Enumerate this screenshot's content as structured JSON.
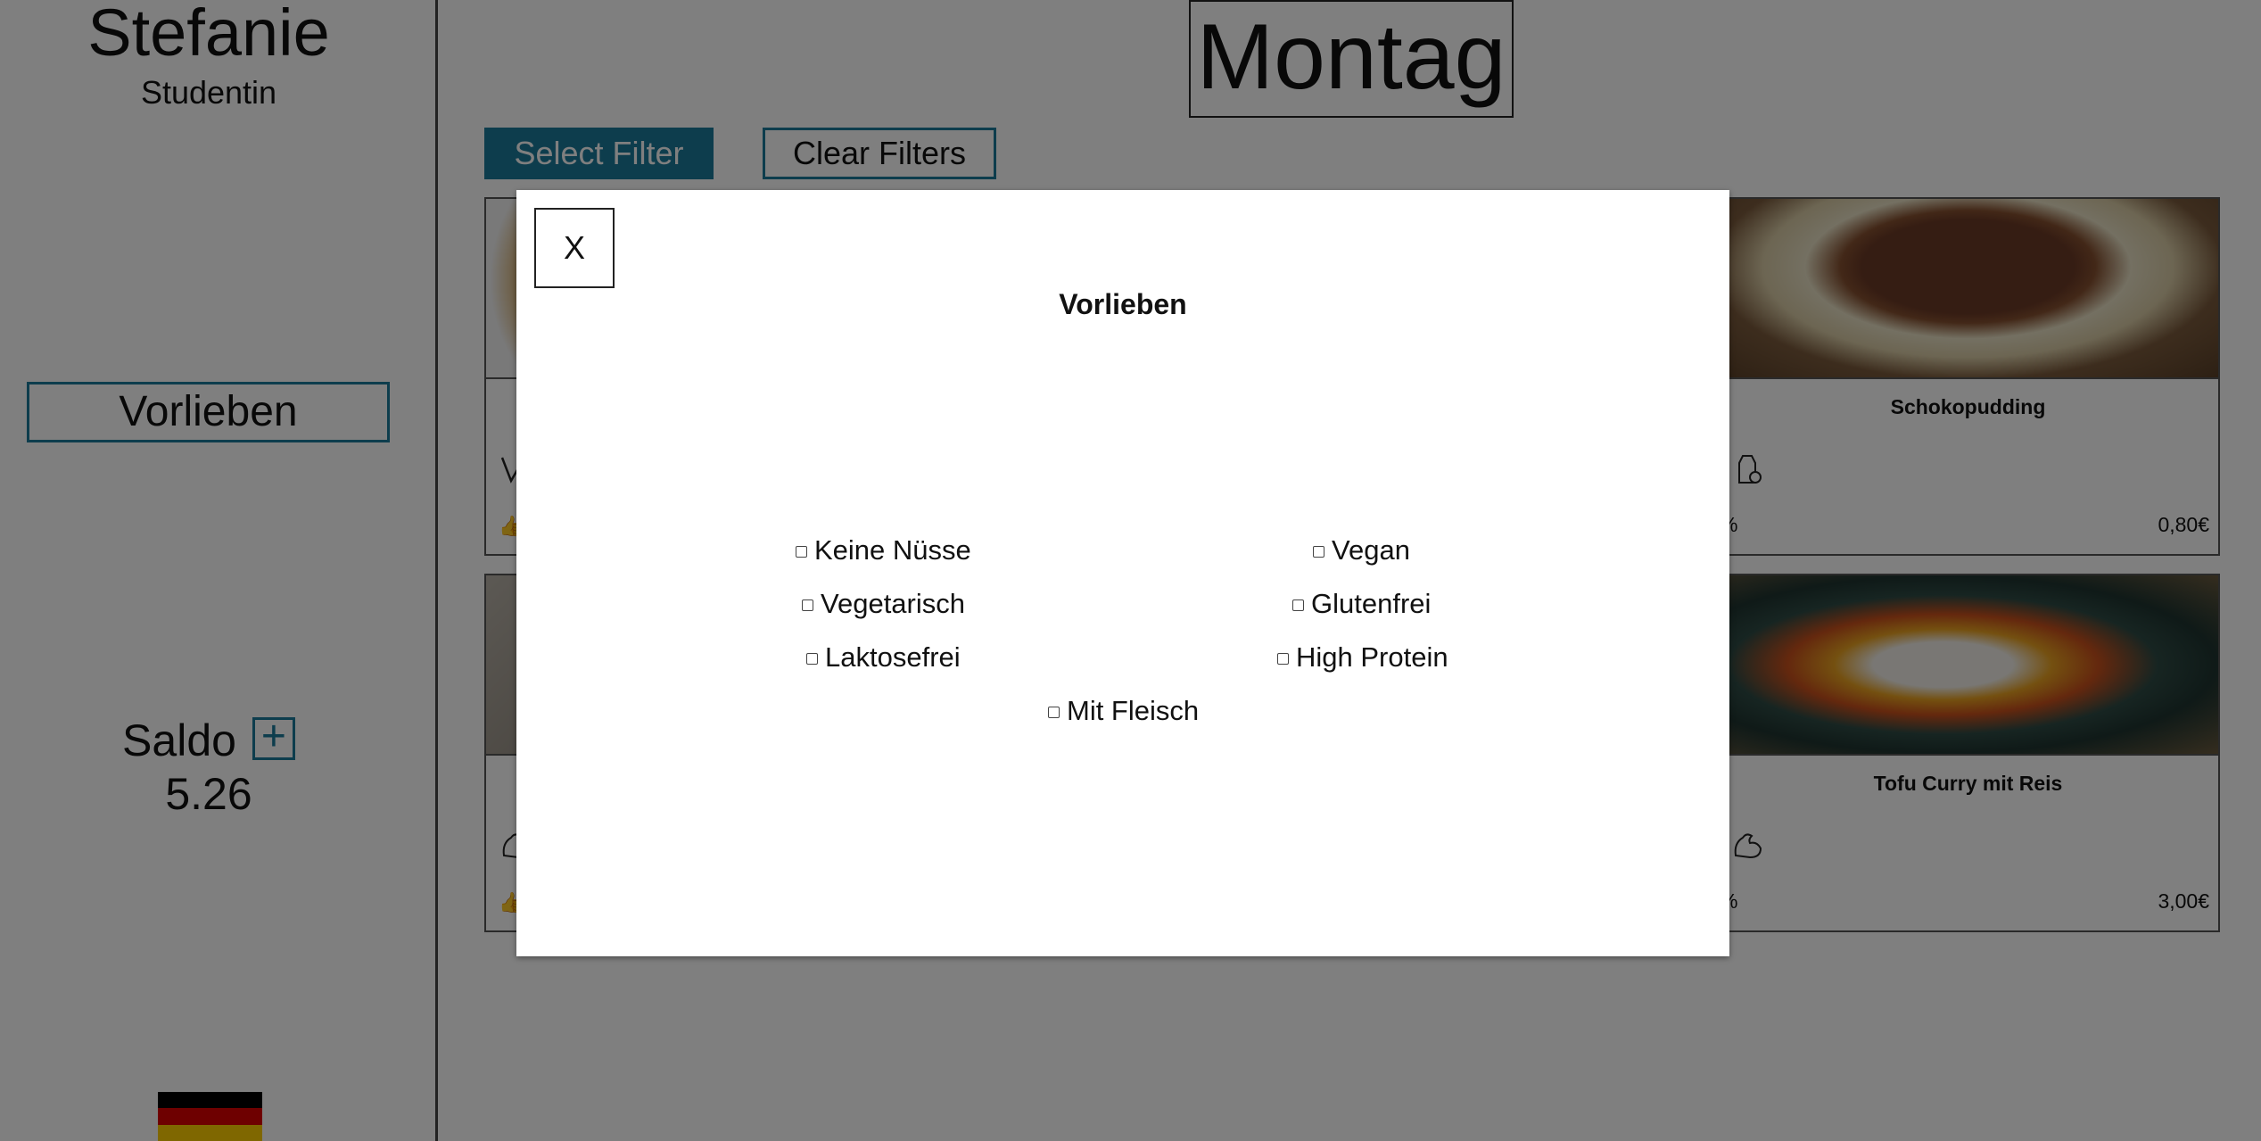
{
  "sidebar": {
    "user_name": "Stefanie",
    "user_role": "Studentin",
    "preferences_button": "Vorlieben",
    "saldo_label": "Saldo",
    "saldo_add": "+",
    "saldo_value": "5.26",
    "language_flag": "german-flag-icon"
  },
  "main": {
    "day_title": "Montag",
    "select_filter": "Select Filter",
    "clear_filters": "Clear Filters",
    "cards": [
      {
        "title": "",
        "percent": "",
        "price": ""
      },
      {
        "title": "Schokopudding",
        "percent": "%",
        "price": "0,80€"
      },
      {
        "title": "",
        "percent": "",
        "price": ""
      },
      {
        "title": "Tofu Curry mit Reis",
        "percent": "%",
        "price": "3,00€"
      }
    ]
  },
  "modal": {
    "close_label": "X",
    "title": "Vorlieben",
    "options": [
      {
        "label": "Keine Nüsse",
        "checked": false
      },
      {
        "label": "Vegan",
        "checked": false
      },
      {
        "label": "Vegetarisch",
        "checked": false
      },
      {
        "label": "Glutenfrei",
        "checked": false
      },
      {
        "label": "Laktosefrei",
        "checked": false
      },
      {
        "label": "High Protein",
        "checked": false
      },
      {
        "label": "Mit Fleisch",
        "checked": false
      }
    ]
  },
  "colors": {
    "accent": "#1a7a9a",
    "overlay": "rgba(0,0,0,0.5)"
  }
}
